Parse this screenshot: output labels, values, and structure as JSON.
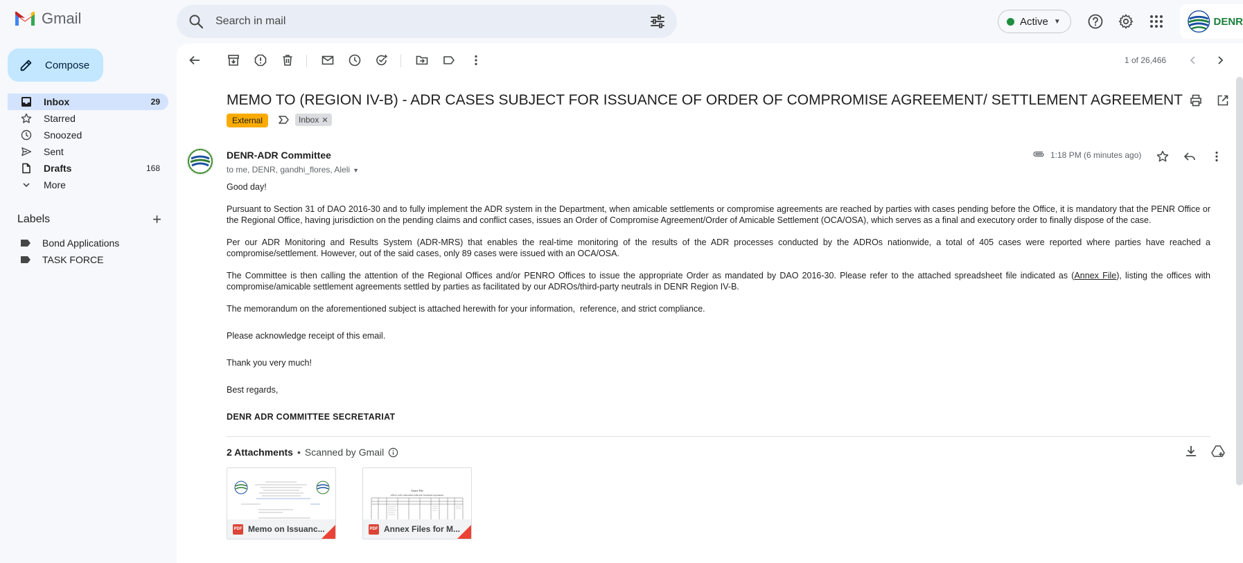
{
  "app": {
    "name": "Gmail",
    "search_placeholder": "Search in mail",
    "status": "Active",
    "account_badge": "DENR"
  },
  "colors": {
    "compose_bg": "#c2e7ff",
    "nav_active_bg": "#d3e3fd",
    "external_chip": "#f9ab00",
    "status_dot": "#1e8e3e",
    "pdf_red": "#db4437"
  },
  "sidebar": {
    "compose_label": "Compose",
    "items": [
      {
        "label": "Inbox",
        "count": "29",
        "icon": "inbox-icon"
      },
      {
        "label": "Starred",
        "count": "",
        "icon": "star-icon"
      },
      {
        "label": "Snoozed",
        "count": "",
        "icon": "clock-icon"
      },
      {
        "label": "Sent",
        "count": "",
        "icon": "send-icon"
      },
      {
        "label": "Drafts",
        "count": "168",
        "icon": "draft-icon"
      },
      {
        "label": "More",
        "count": "",
        "icon": "chevron-down-icon"
      }
    ],
    "labels_title": "Labels",
    "labels": [
      "Bond Applications",
      "TASK FORCE"
    ]
  },
  "toolbar": {
    "pager": "1 of 26,466"
  },
  "email": {
    "subject": "MEMO TO (REGION IV-B) - ADR CASES SUBJECT FOR ISSUANCE OF ORDER OF COMPROMISE AGREEMENT/ SETTLEMENT AGREEMENT",
    "chip_external": "External",
    "chip_inbox": "Inbox",
    "sender": "DENR-ADR Committee",
    "to": "to me, DENR, gandhi_flores, Aleli",
    "time": "1:18 PM (6 minutes ago)",
    "body": {
      "greeting": "Good day!",
      "p1": "Pursuant to Section 31 of DAO 2016-30 and to fully implement the ADR system in the Department, when amicable settlements or compromise agreements are reached by parties with cases pending before the Office, it is mandatory that the PENR Office or the Regional Office, having jurisdiction on the pending claims and conflict cases, issues an Order of Compromise Agreement/Order of Amicable Settlement (OCA/OSA), which serves as a final and executory order to finally dispose of the case.",
      "p2": "Per our ADR Monitoring and Results System (ADR-MRS) that enables the real-time monitoring of the results of the ADR processes conducted by the ADROs nationwide, a total of 405 cases were reported where parties have reached a compromise/settlement. However, out of the said cases, only 89 cases were issued with an OCA/OSA.",
      "p3_a": "The Committee is then calling the attention of the Regional Offices and/or PENRO Offices to issue the appropriate Order as mandated by DAO 2016-30. Please refer to the attached spreadsheet file indicated as (",
      "p3_link": "Annex File",
      "p3_b": "), listing the offices with compromise/amicable settlement agreements settled by parties as facilitated by our ADROs/third-party neutrals in DENR Region IV-B.",
      "p4": "The memorandum on the aforementioned subject is attached herewith for your information,  reference, and strict compliance.",
      "p5": "Please acknowledge receipt of this email.",
      "p6": "Thank you very much!",
      "p7": "Best regards,",
      "signature": "DENR ADR COMMITTEE SECRETARIAT"
    },
    "attachments": {
      "count_label": "2 Attachments",
      "scanned": "Scanned by Gmail",
      "files": [
        {
          "name": "Memo on Issuanc...",
          "type": "PDF"
        },
        {
          "name": "Annex Files for M...",
          "type": "PDF"
        }
      ],
      "preview_annex_title": "Annex File",
      "preview_annex_subtitle": "Offices with Compromise/Amicable Settlement Agreements"
    }
  }
}
